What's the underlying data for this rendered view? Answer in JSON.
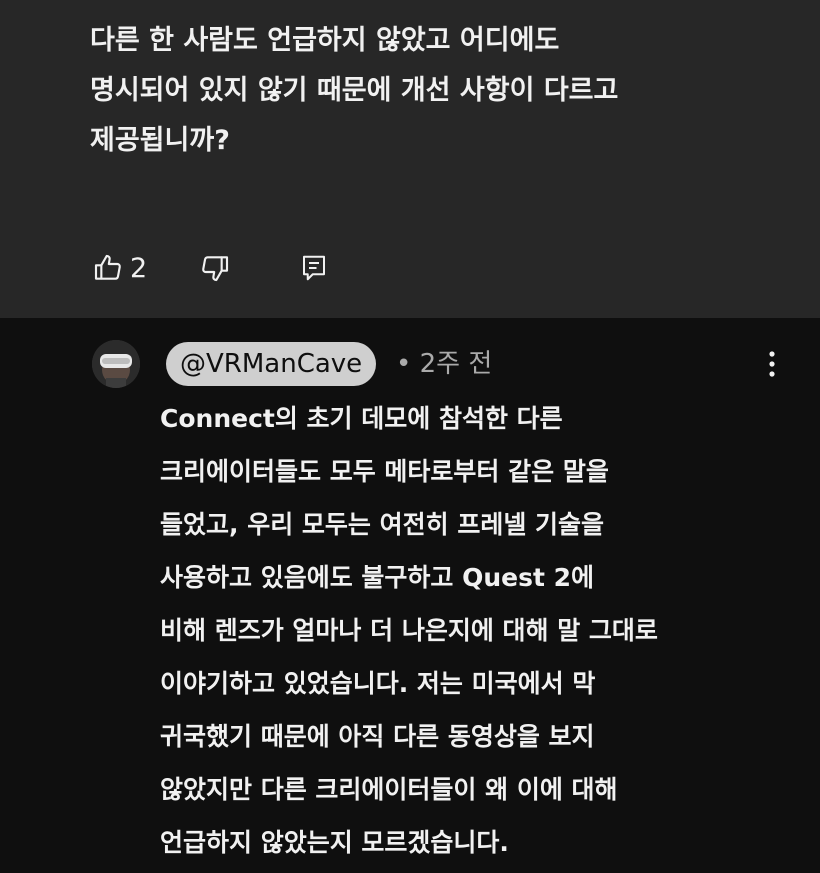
{
  "comment": {
    "lines": [
      "다른 한 사람도 언급하지 않았고 어디에도",
      "명시되어 있지 않기 때문에 개선 사항이 다르고",
      "제공됩니까?"
    ],
    "like_count": "2"
  },
  "reply": {
    "handle": "@VRManCave",
    "time": "• 2주 전",
    "lines": [
      "Connect의 초기 데모에 참석한 다른",
      "크리에이터들도 모두 메타로부터 같은 말을",
      "들었고, 우리 모두는 여전히 프레넬 기술을",
      "사용하고 있음에도 불구하고 Quest 2에",
      "비해 렌즈가 얼마나 더 나은지에 대해 말 그대로",
      "이야기하고 있었습니다. 저는 미국에서 막",
      "귀국했기 때문에 아직 다른 동영상을 보지",
      "않았지만 다른 크리에이터들이 왜 이에 대해",
      "언급하지 않았는지 모르겠습니다."
    ]
  },
  "icons": {
    "like": "thumbs-up-icon",
    "dislike": "thumbs-down-icon",
    "reply": "reply-comment-icon",
    "more": "more-vertical-icon"
  }
}
